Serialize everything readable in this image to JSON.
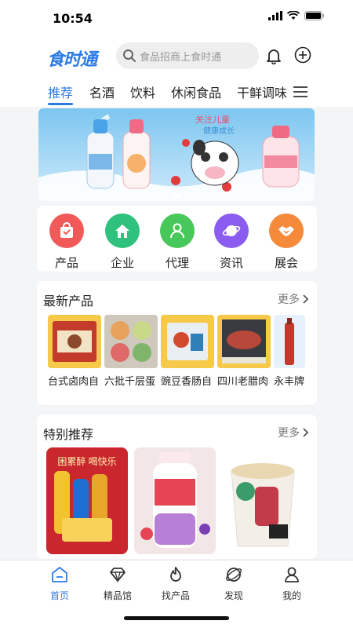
{
  "status": {
    "time": "10:54"
  },
  "header": {
    "logo": "食时通",
    "search_placeholder": "食品招商上食时通"
  },
  "tabs": [
    "推荐",
    "名酒",
    "饮料",
    "休闲食品",
    "干鲜调味"
  ],
  "categories": [
    {
      "label": "产品",
      "color": "#f25a5a",
      "icon": "bag-icon"
    },
    {
      "label": "企业",
      "color": "#2ec27e",
      "icon": "house-icon"
    },
    {
      "label": "代理",
      "color": "#48c75a",
      "icon": "person-icon"
    },
    {
      "label": "资讯",
      "color": "#8a5cf0",
      "icon": "planet-icon"
    },
    {
      "label": "展会",
      "color": "#f58a3a",
      "icon": "handshake-icon"
    }
  ],
  "newest": {
    "title": "最新产品",
    "more": "更多",
    "items": [
      "台式卤肉自",
      "六批千层蛋",
      "豌豆香肠自",
      "四川老腊肉",
      "永丰牌"
    ]
  },
  "special": {
    "title": "特别推荐",
    "more": "更多"
  },
  "banner": {
    "text1": "关注儿童",
    "text2": "健康成长"
  },
  "nav": [
    "首页",
    "精品馆",
    "找产品",
    "发现",
    "我的"
  ],
  "colors": {
    "accent": "#2c7be5"
  }
}
